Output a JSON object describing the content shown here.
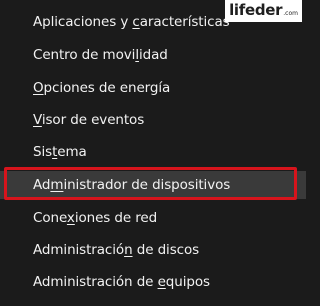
{
  "logo": {
    "text": "lifeder",
    "suffix": ".com"
  },
  "menu": {
    "items": [
      {
        "pre": "Aplicaciones y ",
        "mnemonic": "c",
        "post": "aracterísticas"
      },
      {
        "pre": "Centro de movi",
        "mnemonic": "l",
        "post": "idad"
      },
      {
        "pre": "",
        "mnemonic": "O",
        "post": "pciones de energía"
      },
      {
        "pre": "",
        "mnemonic": "V",
        "post": "isor de eventos"
      },
      {
        "pre": "Sis",
        "mnemonic": "t",
        "post": "ema"
      },
      {
        "pre": "Ad",
        "mnemonic": "m",
        "post": "inistrador de dispositivos"
      },
      {
        "pre": "Cone",
        "mnemonic": "x",
        "post": "iones de red"
      },
      {
        "pre": "Administració",
        "mnemonic": "n",
        "post": " de discos"
      },
      {
        "pre": "Administración de ",
        "mnemonic": "e",
        "post": "quipos"
      }
    ],
    "highlight_color": "#d7141c"
  }
}
